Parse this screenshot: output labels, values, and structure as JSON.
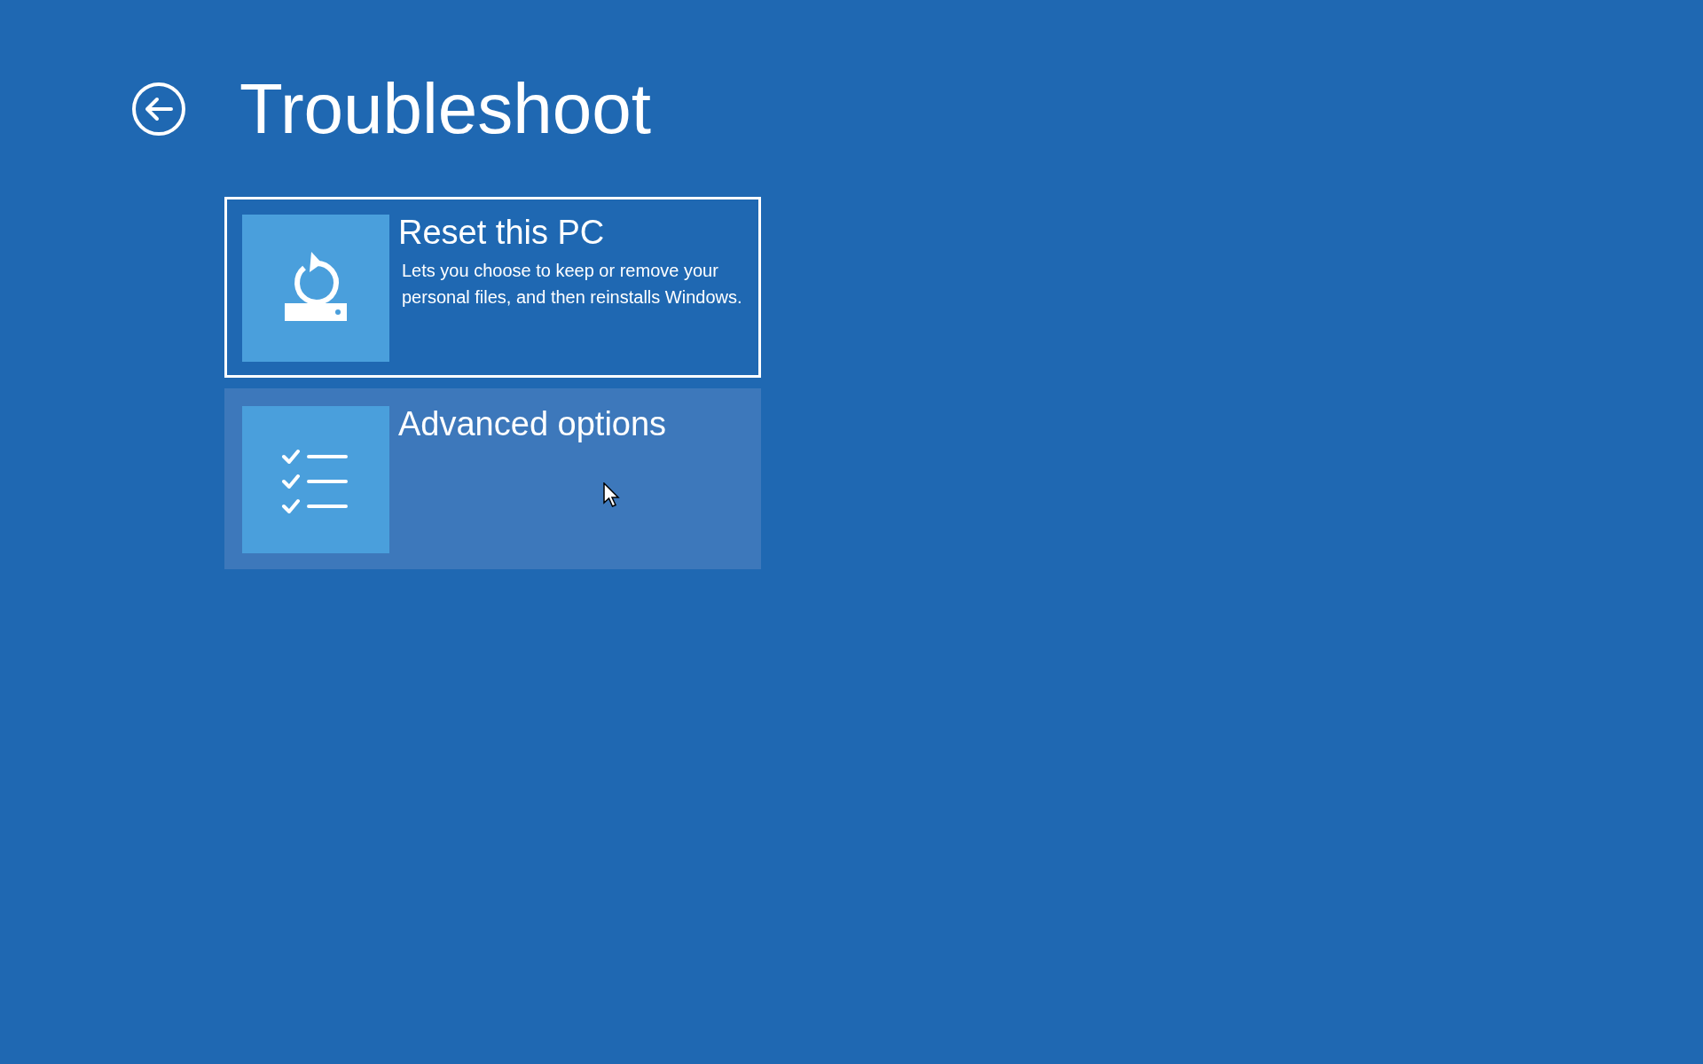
{
  "title": "Troubleshoot",
  "options": [
    {
      "kind": "reset",
      "title": "Reset this PC",
      "description": "Lets you choose to keep or remove your personal files, and then reinstalls Windows.",
      "selected": true,
      "hovered": false
    },
    {
      "kind": "advanced",
      "title": "Advanced options",
      "selected": false,
      "hovered": true
    }
  ]
}
